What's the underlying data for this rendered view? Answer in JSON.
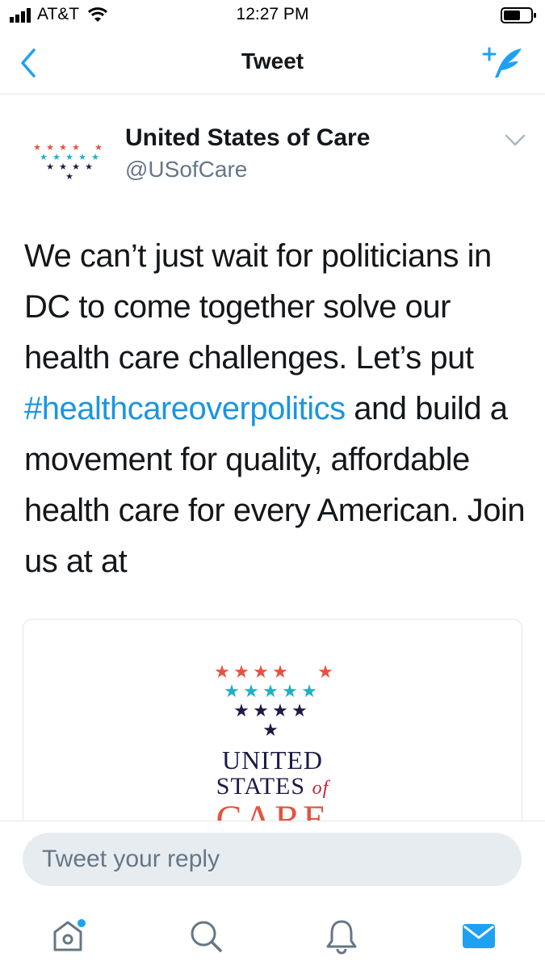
{
  "status_bar": {
    "carrier": "AT&T",
    "time": "12:27 PM"
  },
  "nav": {
    "title": "Tweet"
  },
  "tweet": {
    "author_name": "United States of Care",
    "author_handle": "@USofCare",
    "text_line1": "We can’t just wait for politicians in DC to come together solve our health care challenges. Let’s put ",
    "hashtag": "#healthcareoverpolitics",
    "text_line2": " and build a movement for quality, affordable health care for every American. Join us at at"
  },
  "card": {
    "word1": "UNITED",
    "word2": "STATES",
    "word2_of": "of",
    "word3": "CARE"
  },
  "reply": {
    "placeholder": "Tweet your reply"
  },
  "colors": {
    "accent": "#1da1f2",
    "hashtag": "#1b95e0",
    "star_red": "#e5533f",
    "star_teal": "#1fb0c3",
    "star_navy": "#1d1a45"
  },
  "tab_bar": {
    "icons": [
      "home-icon",
      "search-icon",
      "notifications-icon",
      "messages-icon"
    ],
    "home_has_badge": true,
    "active": "messages"
  }
}
